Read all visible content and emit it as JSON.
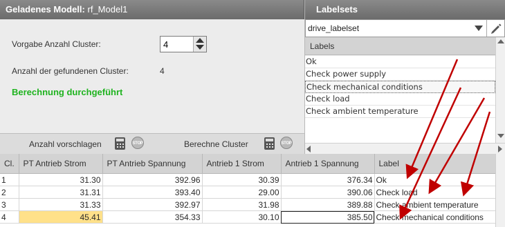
{
  "left_panel": {
    "title_prefix": "Geladenes Modell:",
    "model_name": "rf_Model1",
    "cluster_label": "Vorgabe Anzahl Cluster:",
    "cluster_value": "4",
    "found_label": "Anzahl der gefundenen Cluster:",
    "found_value": "4",
    "status": "Berechnung durchgeführt",
    "status_color": "#1fb31f"
  },
  "toolbar": {
    "suggest_label": "Anzahl vorschlagen",
    "compute_label": "Berechne Cluster",
    "stop_text": "STOP"
  },
  "labelsets": {
    "title": "Labelsets",
    "selected": "drive_labelset",
    "list_header": "Labels",
    "items": [
      "Ok",
      "Check power supply",
      "Check mechanical conditions",
      "Check load",
      "Check ambient temperature"
    ]
  },
  "table": {
    "columns": [
      "Cl.",
      "PT Antrieb Strom",
      "PT Antrieb Spannung",
      "Antrieb 1 Strom",
      "Antrieb 1 Spannung",
      "Label"
    ],
    "rows": [
      [
        "1",
        "31.30",
        "392.96",
        "30.39",
        "376.34",
        "Ok"
      ],
      [
        "2",
        "31.31",
        "393.40",
        "29.00",
        "390.06",
        "Check load"
      ],
      [
        "3",
        "31.33",
        "392.97",
        "31.98",
        "389.88",
        "Check ambient temperature"
      ],
      [
        "4",
        "45.41",
        "354.33",
        "30.10",
        "385.50",
        "Check mechanical conditions"
      ]
    ]
  },
  "colors": {
    "header_bg": "#777777",
    "highlight_cell": "#ffe18a",
    "annotation_arrow": "#c00000"
  },
  "icons": [
    "calculator-icon",
    "stop-icon",
    "chevron-down-icon",
    "pencil-icon"
  ]
}
